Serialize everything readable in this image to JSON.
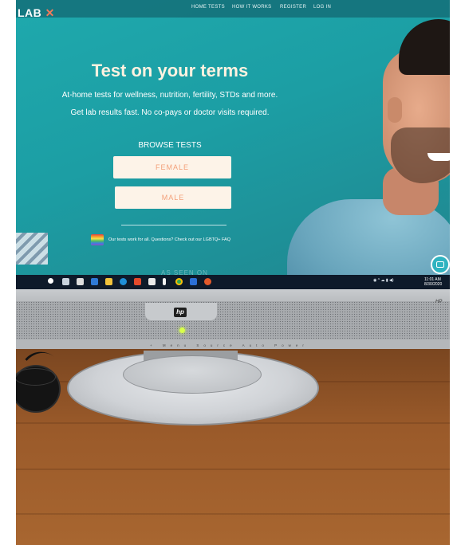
{
  "website": {
    "logo": "LAB",
    "nav": [
      "HOME TESTS",
      "HOW IT WORKS",
      "REGISTER",
      "LOG IN"
    ],
    "hero": {
      "title": "Test on your terms",
      "subtitle_line1": "At-home tests for wellness, nutrition, fertility, STDs and more.",
      "subtitle_line2": "Get lab results fast. No co-pays or doctor visits required.",
      "browse_label": "BROWSE TESTS",
      "buttons": [
        "FEMALE",
        "MALE"
      ]
    },
    "lgbtq_note": "Our tests work for all. Questions? Check out our LGBTQ+ FAQ",
    "accent_color": "#1fa9ad",
    "button_text_color": "#f3a07a"
  },
  "taskbar": {
    "time": "11:01 AM",
    "date": "8/30/2020"
  },
  "monitor": {
    "brand_badge": "hp",
    "brand_text": "HP",
    "reflection_text": "AS SEEN ON",
    "control_labels": "+ Menu Source Auto Power"
  }
}
